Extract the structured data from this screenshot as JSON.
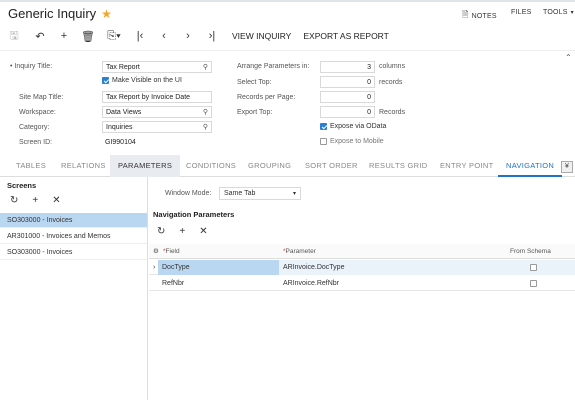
{
  "header": {
    "title": "Generic Inquiry",
    "notes": "NOTES",
    "files": "FILES",
    "tools": "TOOLS"
  },
  "toolbar": {
    "view_inquiry": "VIEW INQUIRY",
    "export_as_report": "EXPORT AS REPORT"
  },
  "form": {
    "inquiry_title_label": "Inquiry Title:",
    "inquiry_title_value": "Tax Report",
    "make_visible_label": "Make Visible on the UI",
    "site_map_title_label": "Site Map Title:",
    "site_map_title_value": "Tax Report by Invoice Date",
    "workspace_label": "Workspace:",
    "workspace_value": "Data Views",
    "category_label": "Category:",
    "category_value": "Inquiries",
    "screen_id_label": "Screen ID:",
    "screen_id_value": "GI990104",
    "arrange_label": "Arrange Parameters in:",
    "arrange_value": "3",
    "arrange_unit": "columns",
    "select_top_label": "Select Top:",
    "select_top_value": "0",
    "select_top_unit": "records",
    "records_per_page_label": "Records per Page:",
    "records_per_page_value": "0",
    "export_top_label": "Export Top:",
    "export_top_value": "0",
    "export_top_unit": "Records",
    "expose_odata_label": "Expose via OData",
    "expose_mobile_label": "Expose to Mobile"
  },
  "tabs": [
    "TABLES",
    "RELATIONS",
    "PARAMETERS",
    "CONDITIONS",
    "GROUPING",
    "SORT ORDER",
    "RESULTS GRID",
    "ENTRY POINT",
    "NAVIGATION"
  ],
  "screens": {
    "title": "Screens",
    "items": [
      "SO303000 - Invoices",
      "AR301000 - Invoices and Memos",
      "SO303000 - Invoices"
    ]
  },
  "navigation": {
    "window_mode_label": "Window Mode:",
    "window_mode_value": "Same Tab",
    "params_title": "Navigation Parameters",
    "columns": [
      "Field",
      "Parameter",
      "From Schema"
    ],
    "rows": [
      {
        "field": "DocType",
        "parameter": "ARInvoice.DocType"
      },
      {
        "field": "RefNbr",
        "parameter": "ARInvoice.RefNbr"
      }
    ]
  },
  "colors": {
    "accent": "#1d74c7",
    "selected_row": "#bad7f1",
    "star": "#f5a623"
  }
}
